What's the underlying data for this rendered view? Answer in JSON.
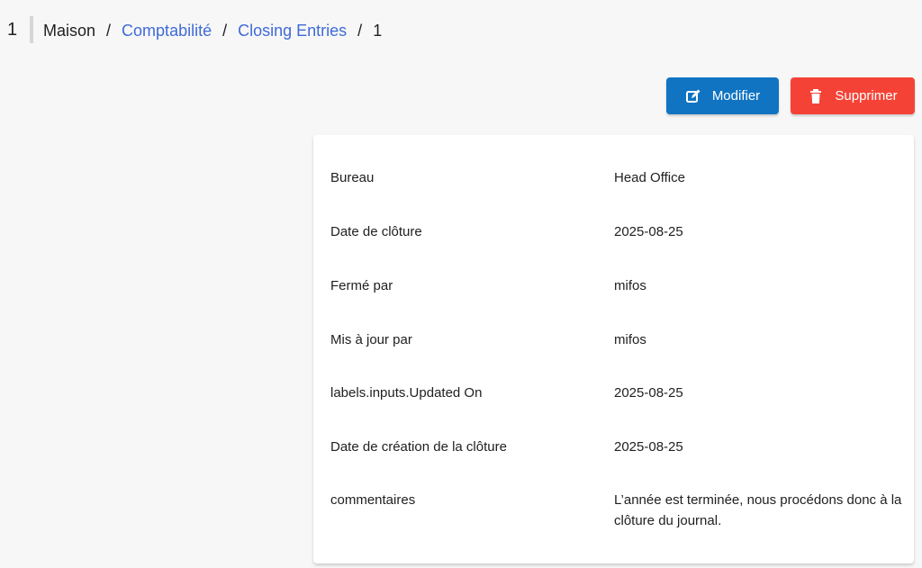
{
  "header": {
    "page_number": "1",
    "breadcrumb": [
      {
        "label": "Maison",
        "link": false
      },
      {
        "label": "Comptabilité",
        "link": true
      },
      {
        "label": "Closing Entries",
        "link": true
      },
      {
        "label": "1",
        "link": false
      }
    ],
    "separator": "/"
  },
  "actions": {
    "edit_label": "Modifier",
    "delete_label": "Supprimer",
    "edit_icon": "edit-icon",
    "delete_icon": "trash-icon",
    "edit_color": "#1174c2",
    "delete_color": "#f44336"
  },
  "details": [
    {
      "label": "Bureau",
      "value": "Head Office"
    },
    {
      "label": "Date de clôture",
      "value": "2025-08-25"
    },
    {
      "label": "Fermé par",
      "value": "mifos"
    },
    {
      "label": "Mis à jour par",
      "value": "mifos"
    },
    {
      "label": "labels.inputs.Updated On",
      "value": "2025-08-25"
    },
    {
      "label": "Date de création de la clôture",
      "value": "2025-08-25"
    },
    {
      "label": "commentaires",
      "value": "L’année est terminée, nous procédons donc à la clôture du journal."
    }
  ]
}
